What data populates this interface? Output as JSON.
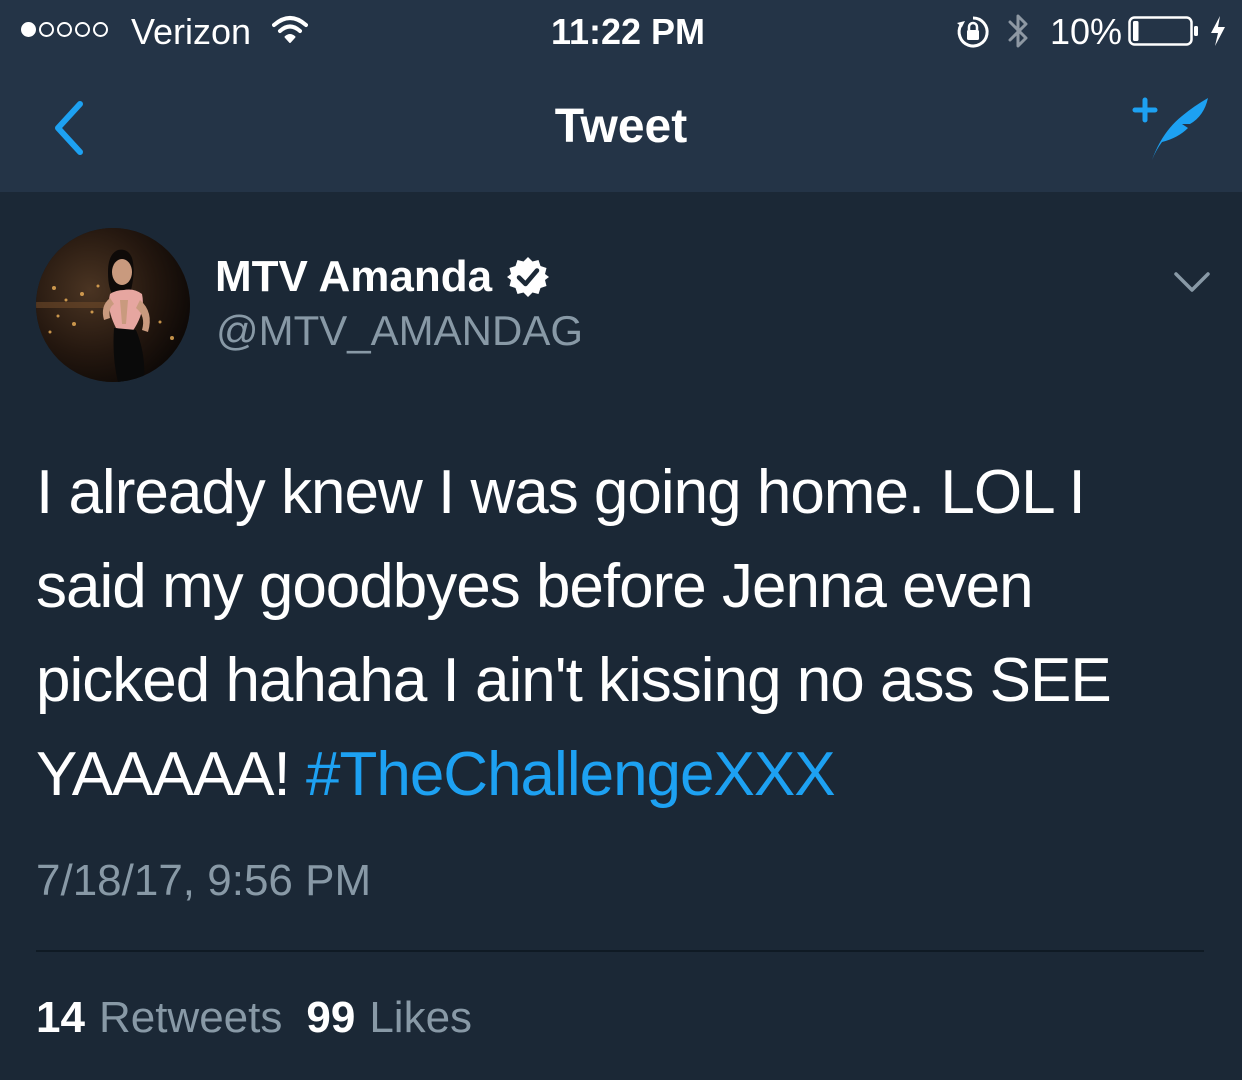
{
  "status_bar": {
    "signal_bars_filled": 1,
    "signal_bars_total": 5,
    "carrier": "Verizon",
    "time": "11:22 PM",
    "battery_percent": "10%",
    "battery_level": 0.1,
    "icons": [
      "wifi-icon",
      "orientation-lock-icon",
      "bluetooth-icon",
      "battery-icon",
      "charging-bolt-icon"
    ]
  },
  "nav": {
    "title": "Tweet",
    "back_icon": "chevron-left-icon",
    "compose_icon": "compose-tweet-icon"
  },
  "tweet": {
    "display_name": "MTV Amanda",
    "verified": true,
    "handle": "@MTV_AMANDAG",
    "text": "I already knew I was going home. LOL I said my goodbyes before Jenna even picked hahaha I ain't kissing no ass SEE YAAAAA! ",
    "hashtag": "#TheChallengeXXX",
    "timestamp": "7/18/17, 9:56 PM",
    "retweets_count": "14",
    "retweets_label": "Retweets",
    "likes_count": "99",
    "likes_label": "Likes"
  },
  "colors": {
    "background": "#1b2836",
    "bar_background": "#243447",
    "accent": "#1da1f2",
    "secondary_text": "#8899a6",
    "primary_text": "#ffffff"
  }
}
